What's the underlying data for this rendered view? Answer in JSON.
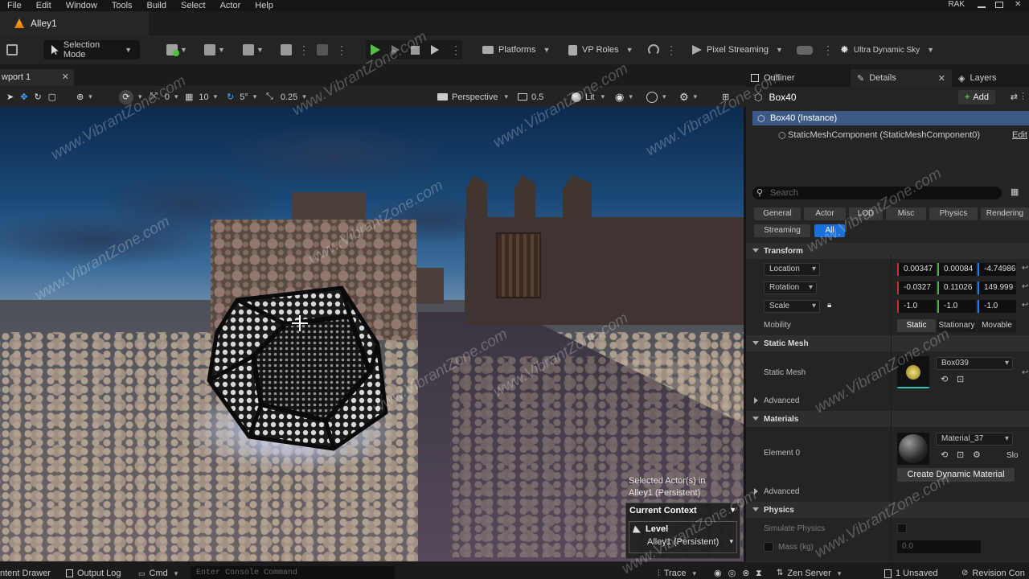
{
  "menu": {
    "items": [
      "File",
      "Edit",
      "Window",
      "Tools",
      "Build",
      "Select",
      "Actor",
      "Help"
    ],
    "user": "RAK"
  },
  "level_tab": {
    "label": "Alley1"
  },
  "toolbar": {
    "selection_mode": "Selection Mode",
    "platforms": "Platforms",
    "vp_roles": "VP Roles",
    "pixel_streaming": "Pixel Streaming",
    "ultra_dynamic_sky": "Ultra Dynamic Sky"
  },
  "viewport_tab": {
    "label": "wport 1"
  },
  "viewport_toolbar": {
    "rotation_snap": "0",
    "grid_snap": "10",
    "angle_snap": "5°",
    "scale_snap": "0.25",
    "perspective": "Perspective",
    "camera_speed": "0.5",
    "lit": "Lit"
  },
  "viewport_overlay": {
    "selected_title": "Selected Actor(s) in",
    "selected_level": "Alley1 (Persistent)",
    "current_context": "Current Context",
    "level_label": "Level",
    "level_value": "Alley1 (Persistent)"
  },
  "panel_tabs": {
    "outliner": "Outliner",
    "details": "Details",
    "layers": "Layers"
  },
  "details": {
    "actor_name": "Box40",
    "add_button": "Add",
    "instance": "Box40 (Instance)",
    "component": "StaticMeshComponent (StaticMeshComponent0)",
    "edit": "Edit",
    "search_placeholder": "Search",
    "filters": [
      "General",
      "Actor",
      "LOD",
      "Misc",
      "Physics",
      "Rendering"
    ],
    "filters2": [
      "Streaming",
      "All"
    ],
    "transform": {
      "title": "Transform",
      "location_label": "Location",
      "location": [
        "0.00347",
        "0.00084",
        "-4.74986"
      ],
      "rotation_label": "Rotation",
      "rotation": [
        "-0.0327",
        "0.11026",
        "149.999"
      ],
      "scale_label": "Scale",
      "scale": [
        "-1.0",
        "-1.0",
        "-1.0"
      ],
      "mobility_label": "Mobility",
      "mobility": [
        "Static",
        "Stationary",
        "Movable"
      ]
    },
    "static_mesh": {
      "title": "Static Mesh",
      "label": "Static Mesh",
      "value": "Box039",
      "advanced": "Advanced"
    },
    "materials": {
      "title": "Materials",
      "element_label": "Element 0",
      "value": "Material_37",
      "slot_text": "Slo",
      "create_dynamic": "Create Dynamic Material",
      "advanced": "Advanced"
    },
    "physics": {
      "title": "Physics",
      "simulate": "Simulate Physics",
      "mass": "Mass (kg)",
      "mass_value": "0.0"
    }
  },
  "statusbar": {
    "content_drawer": "ntent Drawer",
    "output_log": "Output Log",
    "cmd": "Cmd",
    "console_placeholder": "Enter Console Command",
    "trace": "Trace",
    "zen_server": "Zen Server",
    "unsaved": "1 Unsaved",
    "revision": "Revision Con"
  },
  "watermark": "www.VibrantZone.com",
  "colors": {
    "accent_blue": "#1a70d8",
    "play_green": "#4fc341",
    "selection_row": "#3d5a86"
  }
}
